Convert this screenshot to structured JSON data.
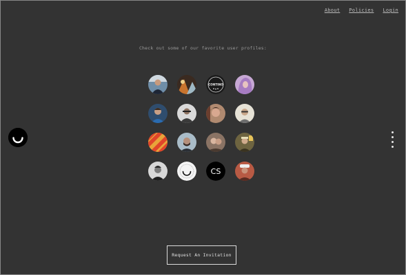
{
  "nav": {
    "items": [
      {
        "label": "About"
      },
      {
        "label": "Policies"
      },
      {
        "label": "Login"
      }
    ]
  },
  "tagline": "Check out some of our favorite user profiles:",
  "avatars": [
    {
      "icon": "person-photo-avatar",
      "color": "#5a7a94"
    },
    {
      "icon": "person-photo-avatar",
      "color": "#8a5a3a"
    },
    {
      "icon": "contino-badge-avatar",
      "color": "#1a1a1a",
      "badge_text": "CONTINO"
    },
    {
      "icon": "purple-hair-avatar",
      "color": "#b98ac9"
    },
    {
      "icon": "person-photo-avatar",
      "color": "#3e6a9a"
    },
    {
      "icon": "person-photo-avatar",
      "color": "#6a6a6a"
    },
    {
      "icon": "person-photo-avatar",
      "color": "#7a5a4a"
    },
    {
      "icon": "person-photo-avatar",
      "color": "#c9c2b0"
    },
    {
      "icon": "orange-pattern-avatar",
      "color": "#e0662a"
    },
    {
      "icon": "person-photo-avatar",
      "color": "#8aa0ac"
    },
    {
      "icon": "person-photo-avatar",
      "color": "#8a7060"
    },
    {
      "icon": "person-photo-avatar",
      "color": "#7a6a3a"
    },
    {
      "icon": "person-photo-avatar",
      "color": "#555555"
    },
    {
      "icon": "ello-smile-avatar",
      "color": "#f4f4f4"
    },
    {
      "icon": "cs-monogram-avatar",
      "color": "#000000",
      "badge_text": "CS"
    },
    {
      "icon": "person-photo-avatar",
      "color": "#8a4a3a"
    }
  ],
  "side_dots": 4,
  "invite_button": "Request An Invitation",
  "colors": {
    "background": "#333333",
    "text": "#aaaaaa",
    "button_border": "#dddddd"
  }
}
